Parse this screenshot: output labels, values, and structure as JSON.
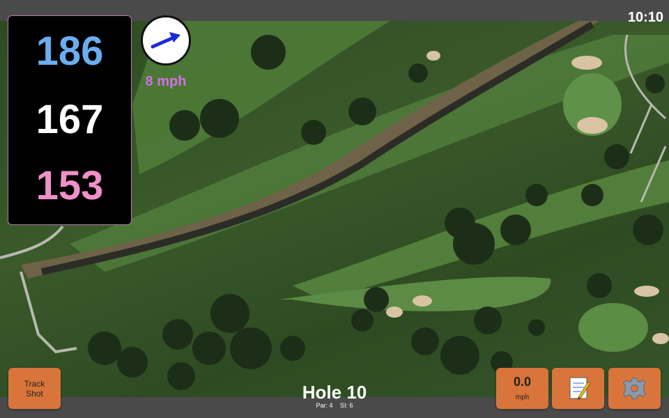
{
  "clock": {
    "time": "10:10"
  },
  "distances": {
    "back": "186",
    "middle": "167",
    "front": "153"
  },
  "wind": {
    "speed": "8 mph",
    "arrow_icon": "wind-direction-arrow-icon"
  },
  "hole": {
    "title": "Hole 10",
    "par": "Par: 4",
    "si": "SI: 6"
  },
  "buttons": {
    "track_shot_line1": "Track",
    "track_shot_line2": "Shot",
    "speed_value": "0.0",
    "speed_unit": "mph",
    "notes_icon": "notepad-icon",
    "settings_icon": "gear-icon"
  },
  "colors": {
    "back_distance": "#6aaef0",
    "middle_distance": "#ffffff",
    "front_distance": "#f090c8",
    "wind_label": "#d070e8",
    "button": "#d9753a"
  }
}
